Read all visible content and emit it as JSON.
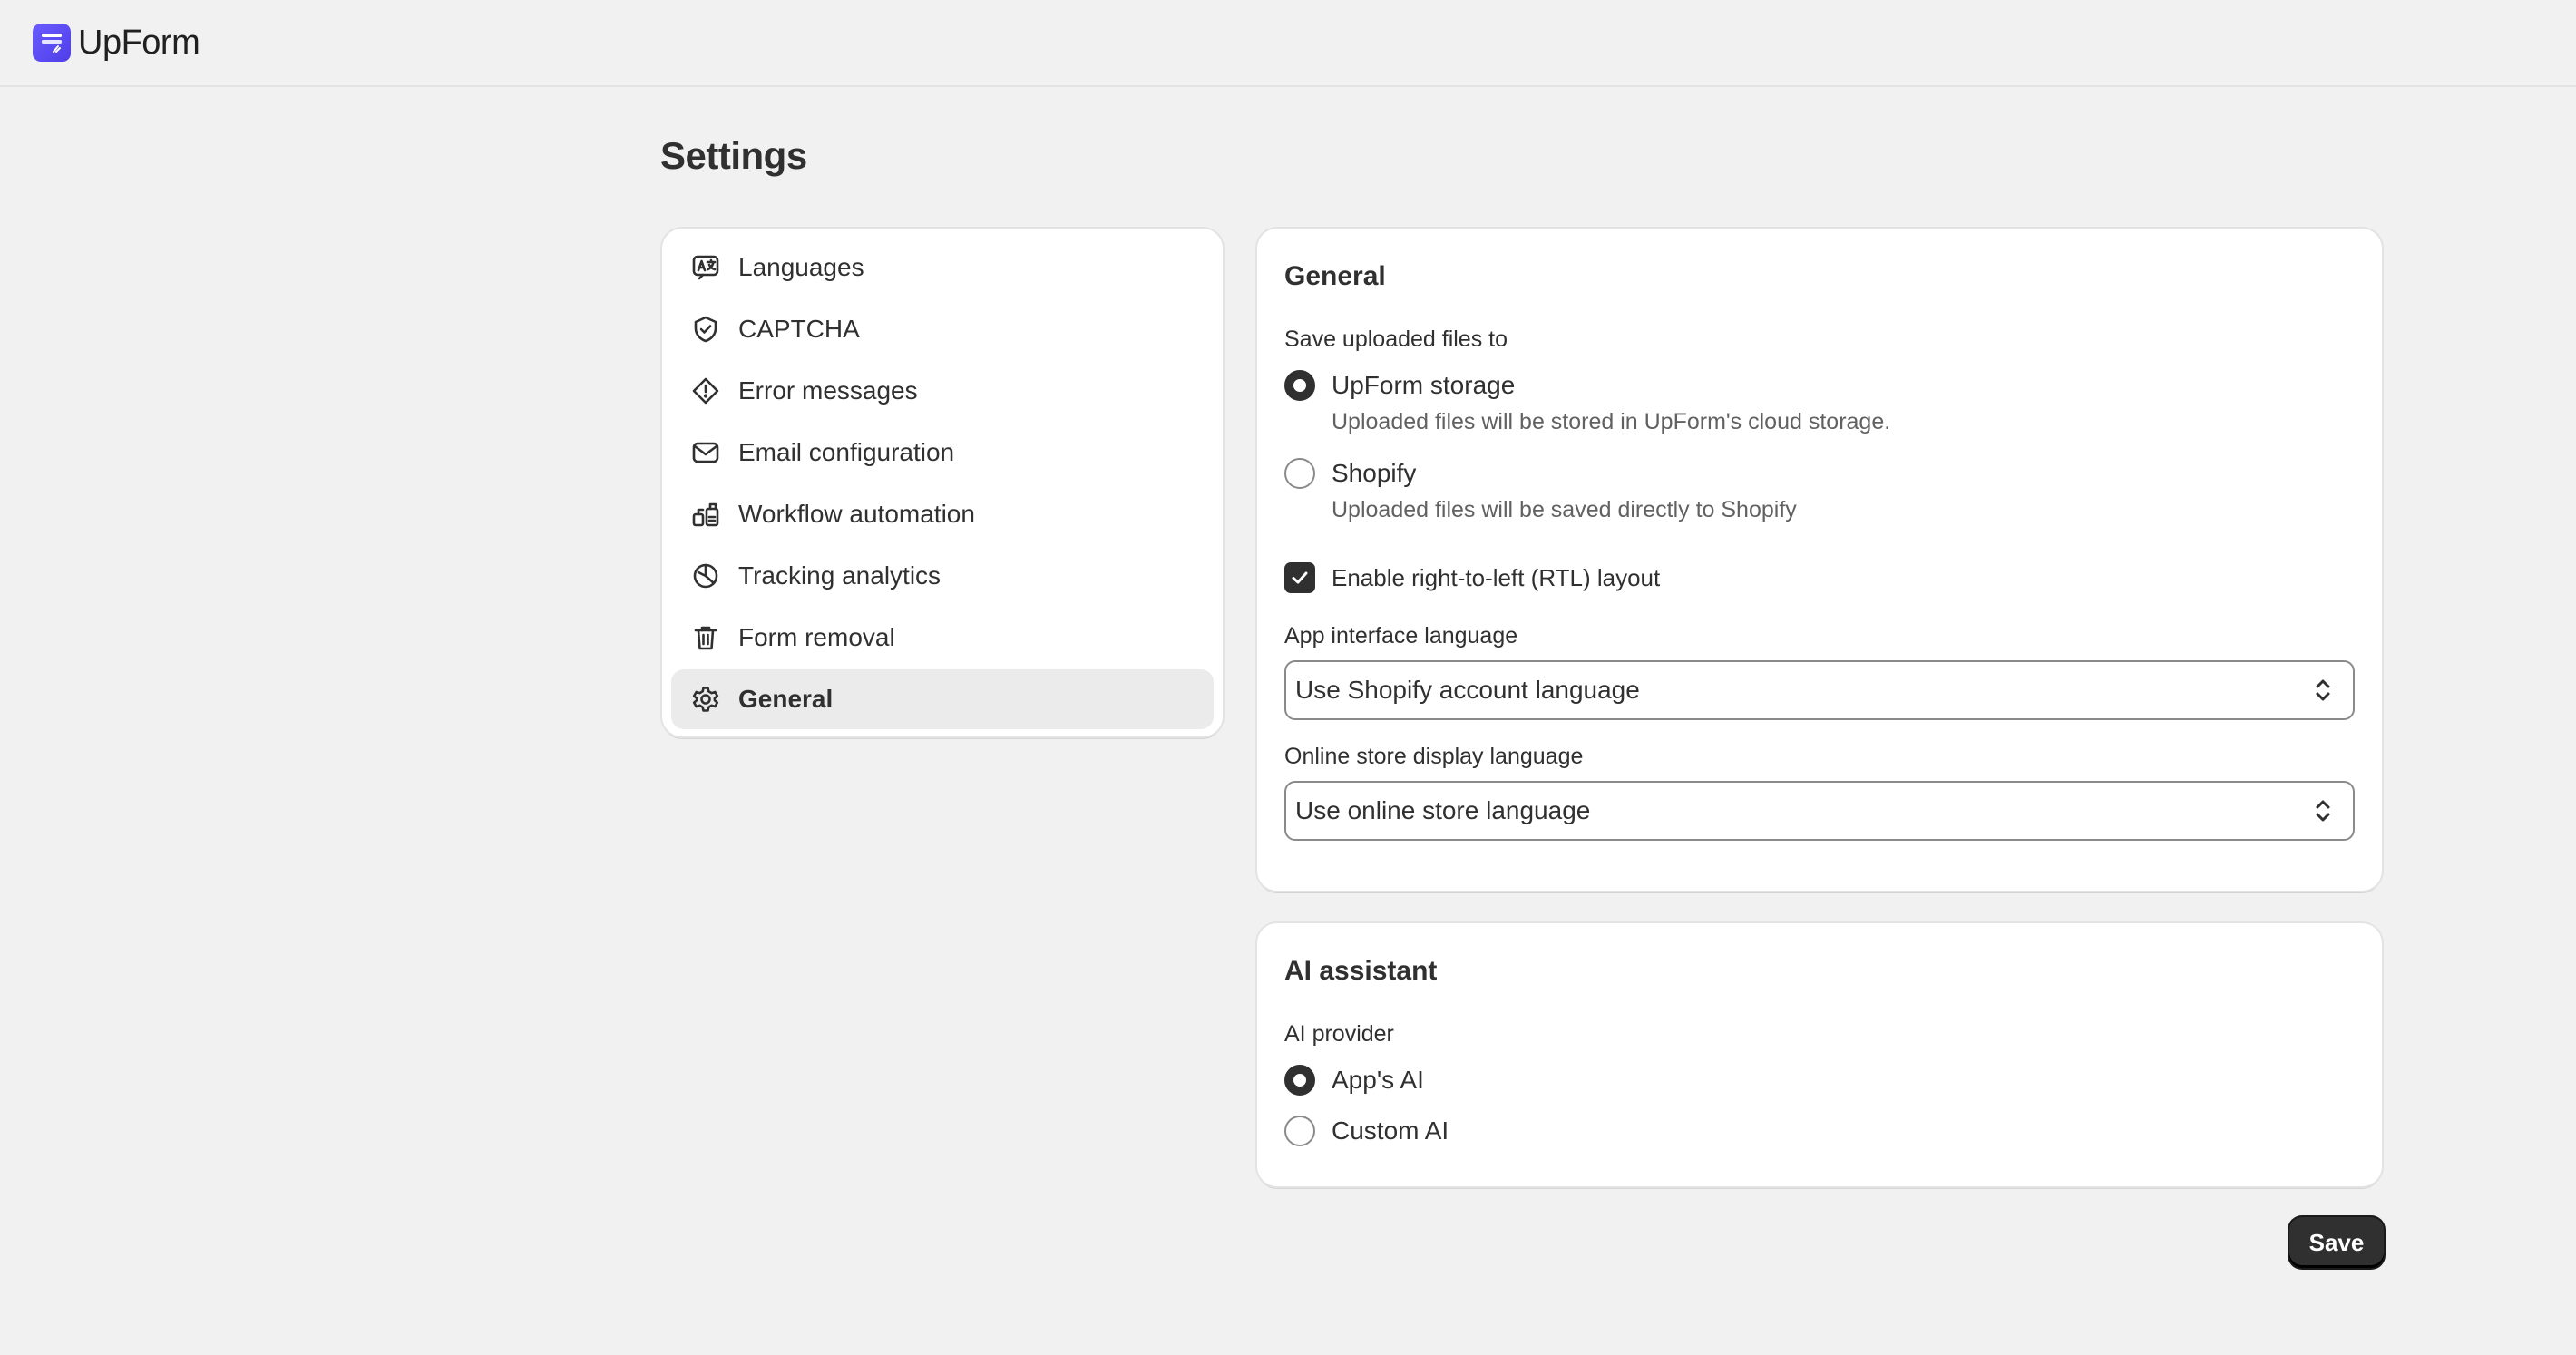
{
  "app": {
    "name": "UpForm"
  },
  "page": {
    "title": "Settings"
  },
  "nav": {
    "items": [
      {
        "label": "Languages",
        "icon": "language-icon"
      },
      {
        "label": "CAPTCHA",
        "icon": "shield-check-icon"
      },
      {
        "label": "Error messages",
        "icon": "alert-diamond-icon"
      },
      {
        "label": "Email configuration",
        "icon": "email-icon"
      },
      {
        "label": "Workflow automation",
        "icon": "workflow-icon"
      },
      {
        "label": "Tracking analytics",
        "icon": "analytics-icon"
      },
      {
        "label": "Form removal",
        "icon": "trash-icon"
      },
      {
        "label": "General",
        "icon": "gear-icon",
        "active": true
      }
    ]
  },
  "general": {
    "title": "General",
    "upload_label": "Save uploaded files to",
    "upload_options": [
      {
        "label": "UpForm storage",
        "help": "Uploaded files will be stored in UpForm's cloud storage.",
        "checked": true
      },
      {
        "label": "Shopify",
        "help": "Uploaded files will be saved directly to Shopify",
        "checked": false
      }
    ],
    "rtl_label": "Enable right-to-left (RTL) layout",
    "rtl_checked": true,
    "app_language_label": "App interface language",
    "app_language_value": "Use Shopify account language",
    "store_language_label": "Online store display language",
    "store_language_value": "Use online store language"
  },
  "ai": {
    "title": "AI assistant",
    "provider_label": "AI provider",
    "options": [
      {
        "label": "App's AI",
        "checked": true
      },
      {
        "label": "Custom AI",
        "checked": false
      }
    ]
  },
  "actions": {
    "save_label": "Save"
  },
  "colors": {
    "primary_button": "#303030",
    "background": "#f1f1f1",
    "brand": "#5b4cf0"
  }
}
